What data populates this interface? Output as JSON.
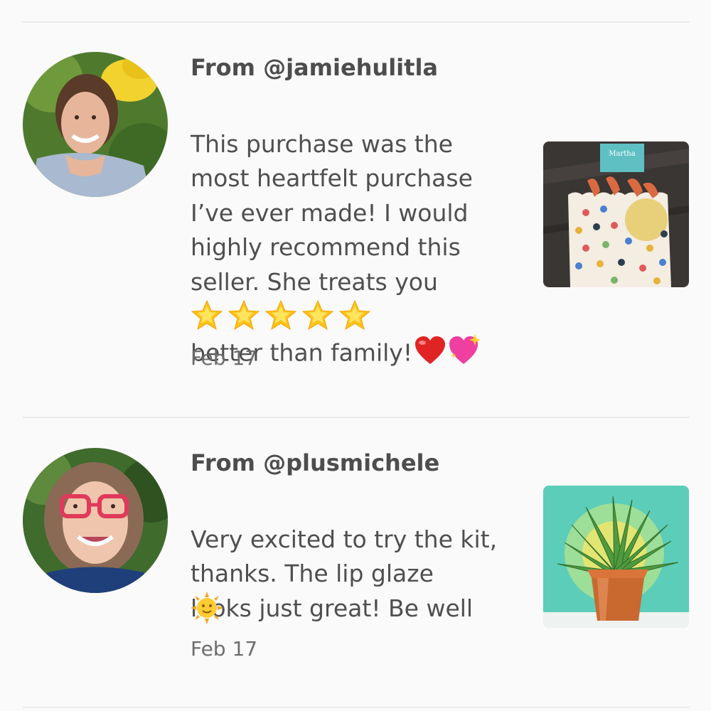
{
  "reviews": [
    {
      "from": "From @jamiehulitla",
      "text": "This purchase was the\nmost heartfelt purchase\nI’ve ever made! I would\nhighly recommend this\nseller. She treats you\nbetter than family!",
      "text_emojis": [
        "red-heart",
        "sparkling-heart"
      ],
      "rating_emojis": [
        "glowing-star",
        "glowing-star",
        "glowing-star",
        "glowing-star",
        "glowing-star"
      ],
      "date": "Feb 17",
      "thumbnail_label": "Martha"
    },
    {
      "from": "From @plusmichele",
      "text": "Very excited to try the kit,\nthanks. The lip glaze\nlooks just great! Be well",
      "text_emojis": [
        "sun-with-face"
      ],
      "date": "Feb 17"
    }
  ]
}
